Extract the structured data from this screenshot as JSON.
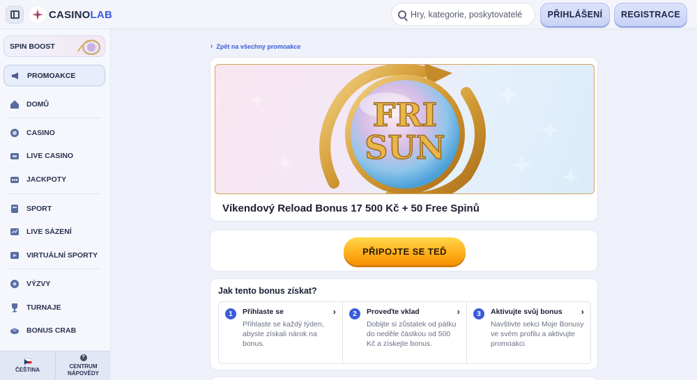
{
  "header": {
    "logo_prefix": "CASINO",
    "logo_suffix": "LAB",
    "search_placeholder": "Hry, kategorie, poskytovatelé",
    "login_label": "PŘIHLÁŠENÍ",
    "register_label": "REGISTRACE"
  },
  "sidebar": {
    "spin_boost": "SPIN BOOST",
    "promo": "PROMOAKCE",
    "items": [
      {
        "label": "DOMŮ",
        "icon": "home-icon"
      },
      {
        "label": "CASINO",
        "icon": "casino-chip-icon"
      },
      {
        "label": "LIVE CASINO",
        "icon": "live-cards-icon"
      },
      {
        "label": "JACKPOTY",
        "icon": "jackpot-slot-icon"
      },
      {
        "label": "SPORT",
        "icon": "sport-icon"
      },
      {
        "label": "LIVE SÁZENÍ",
        "icon": "live-betting-icon"
      },
      {
        "label": "VIRTUÁLNÍ SPORTY",
        "icon": "virtual-sports-icon"
      },
      {
        "label": "VÝZVY",
        "icon": "challenges-icon"
      },
      {
        "label": "TURNAJE",
        "icon": "trophy-icon"
      },
      {
        "label": "BONUS CRAB",
        "icon": "bonus-crab-icon"
      }
    ],
    "footer": {
      "language": "ČEŠTINA",
      "help_line1": "CENTRUM",
      "help_line2": "NÁPOVĚDY"
    }
  },
  "main": {
    "back_link": "Zpět na všechny promoakce",
    "banner_line1": "FRI",
    "banner_line2": "SUN",
    "promo_title": "Víkendový Reload Bonus 17 500 Kč + 50 Free Spinů",
    "cta_label": "PŘIPOJTE SE TEĎ",
    "steps_title": "Jak tento bonus získat?",
    "steps": [
      {
        "num": "1",
        "title": "Přihlaste se",
        "text": "Přihlaste se každý týden, abyste získali nárok na bonus."
      },
      {
        "num": "2",
        "title": "Proveďte vklad",
        "text": "Dobijte si zůstatek od pátku do neděle částkou od 500 Kč a získejte bonus."
      },
      {
        "num": "3",
        "title": "Aktivujte svůj bonus",
        "text": "Navštivte sekci Moje Bonusy ve svém profilu a aktivujte promoakci."
      }
    ]
  },
  "colors": {
    "accent": "#3b5bdb",
    "cta_orange": "#ffab1a",
    "banner_gold": "#d4a35a"
  }
}
